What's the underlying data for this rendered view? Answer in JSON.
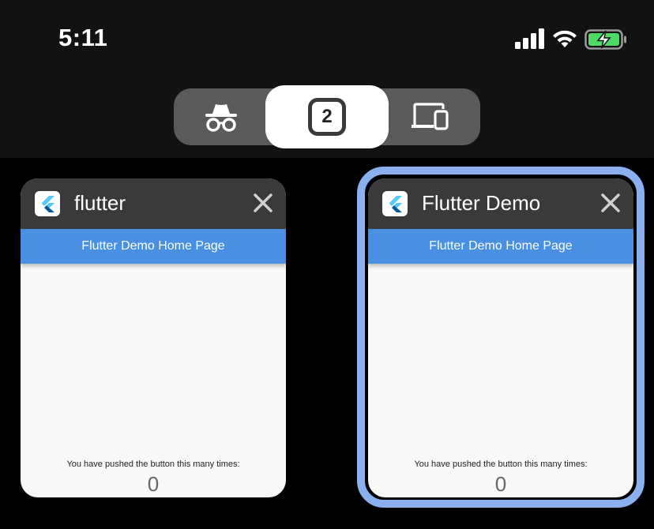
{
  "status_bar": {
    "time": "5:11"
  },
  "switcher": {
    "incognito_icon": "incognito-icon",
    "tab_count": "2",
    "devices_icon": "devices-icon"
  },
  "tabs": [
    {
      "title": "flutter",
      "appbar_title": "Flutter Demo Home Page",
      "message": "You have pushed the button this many times:",
      "counter": "0",
      "selected": false
    },
    {
      "title": "Flutter Demo",
      "appbar_title": "Flutter Demo Home Page",
      "message": "You have pushed the button this many times:",
      "counter": "0",
      "selected": true
    }
  ],
  "colors": {
    "appbar": "#4a90e2",
    "selection_ring": "#8ab0f0",
    "battery_charging": "#4cd964"
  }
}
